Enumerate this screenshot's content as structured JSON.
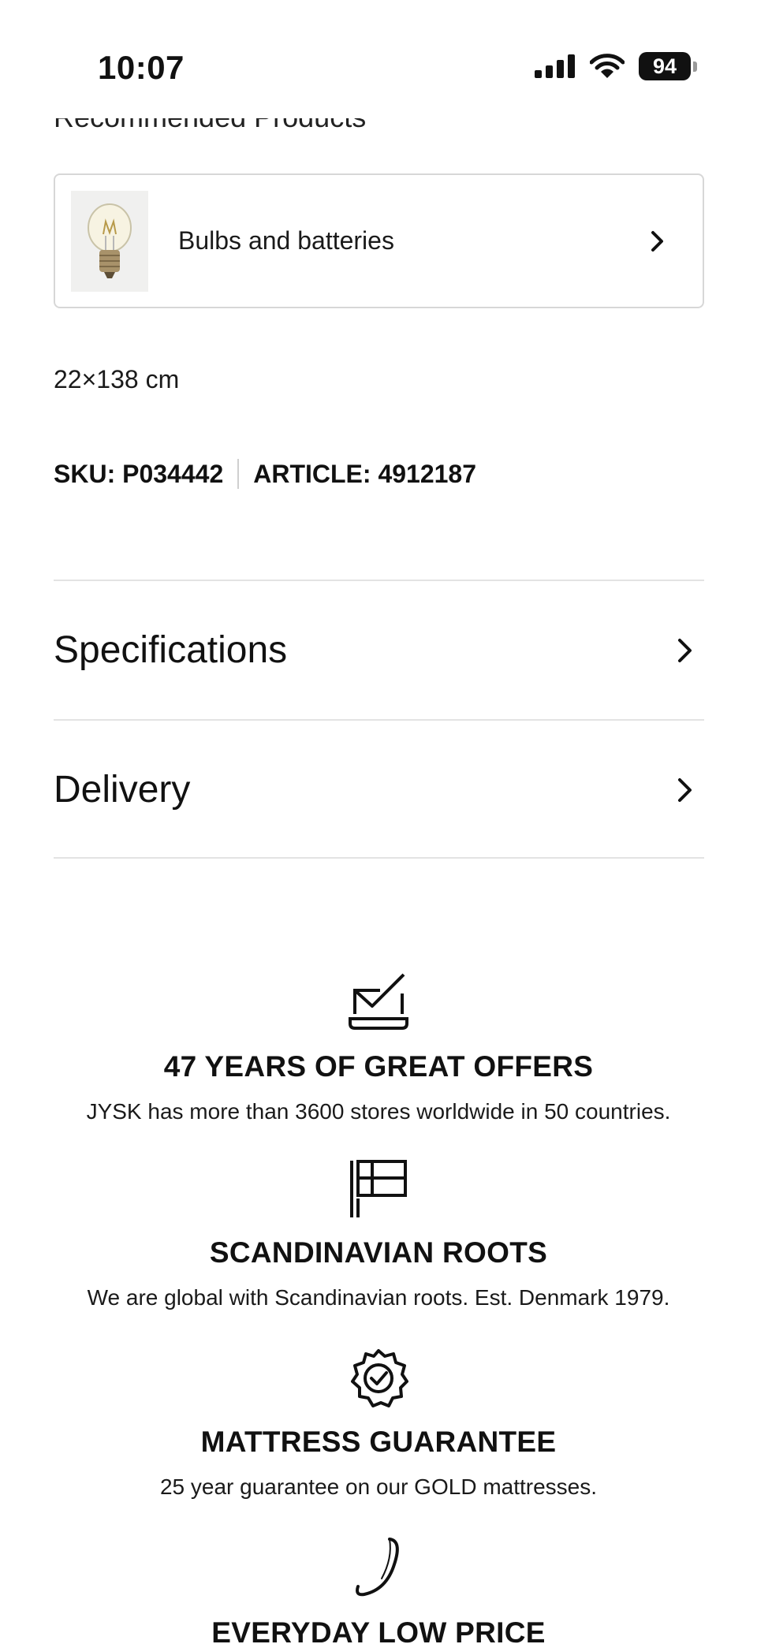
{
  "status_bar": {
    "time": "10:07",
    "battery": "94"
  },
  "section": {
    "heading": "Recommended Products"
  },
  "recommended": {
    "label": "Bulbs and batteries",
    "thumb_icon": "light-bulb-icon"
  },
  "product": {
    "dimensions": "22×138 cm",
    "sku": "SKU: P034442",
    "article": "ARTICLE: 4912187"
  },
  "accordions": [
    {
      "label": "Specifications"
    },
    {
      "label": "Delivery"
    }
  ],
  "usps": [
    {
      "icon": "laptop-check-icon",
      "title": "47 YEARS OF GREAT OFFERS",
      "text": "JYSK has more than 3600 stores worldwide in 50 countries."
    },
    {
      "icon": "scandinavian-flag-icon",
      "title": "SCANDINAVIAN ROOTS",
      "text": "We are global with Scandinavian roots. Est. Denmark 1979."
    },
    {
      "icon": "badge-check-icon",
      "title": "MATTRESS GUARANTEE",
      "text": "25 year guarantee on our GOLD mattresses."
    },
    {
      "icon": "price-swirl-icon",
      "title": "EVERYDAY LOW PRICE",
      "text": ""
    }
  ],
  "colors": {
    "text": "#111111",
    "border": "#d7d7d7",
    "divider": "#e3e3e3"
  }
}
